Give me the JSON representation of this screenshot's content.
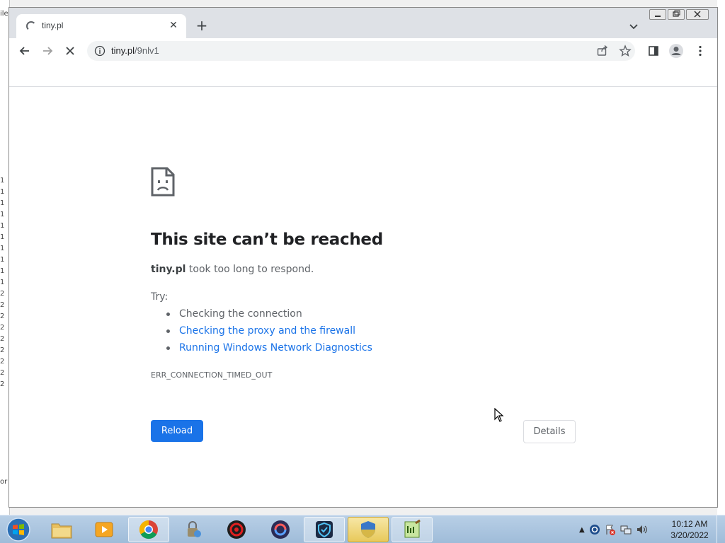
{
  "browser": {
    "tab_title": "tiny.pl",
    "url_host": "tiny.pl",
    "url_path": "/9nlv1"
  },
  "error_page": {
    "title": "This site can’t be reached",
    "host": "tiny.pl",
    "description": " took too long to respond.",
    "try_label": "Try:",
    "suggestions": [
      {
        "text": "Checking the connection",
        "link": false
      },
      {
        "text": "Checking the proxy and the firewall",
        "link": true
      },
      {
        "text": "Running Windows Network Diagnostics",
        "link": true
      }
    ],
    "error_code": "ERR_CONNECTION_TIMED_OUT",
    "reload_label": "Reload",
    "details_label": "Details"
  },
  "background_window": {
    "fragments": [
      "ile",
      "1",
      "1",
      "1",
      "1",
      "1",
      "1",
      "1",
      "1",
      "1",
      "1",
      "2",
      "2",
      "2",
      "2",
      "2",
      "2",
      "2",
      "2",
      "2",
      "or"
    ]
  },
  "taskbar": {
    "apps": [
      "windows-explorer",
      "media-player",
      "google-chrome",
      "security-app",
      "red-app",
      "purple-app",
      "shield-app",
      "uac-shield",
      "notepad-plus-plus"
    ],
    "time": "10:12 AM",
    "date": "3/20/2022"
  },
  "colors": {
    "link": "#1a73e8",
    "reload_bg": "#1a73e8",
    "text_primary": "#202124",
    "text_secondary": "#5f6368"
  }
}
